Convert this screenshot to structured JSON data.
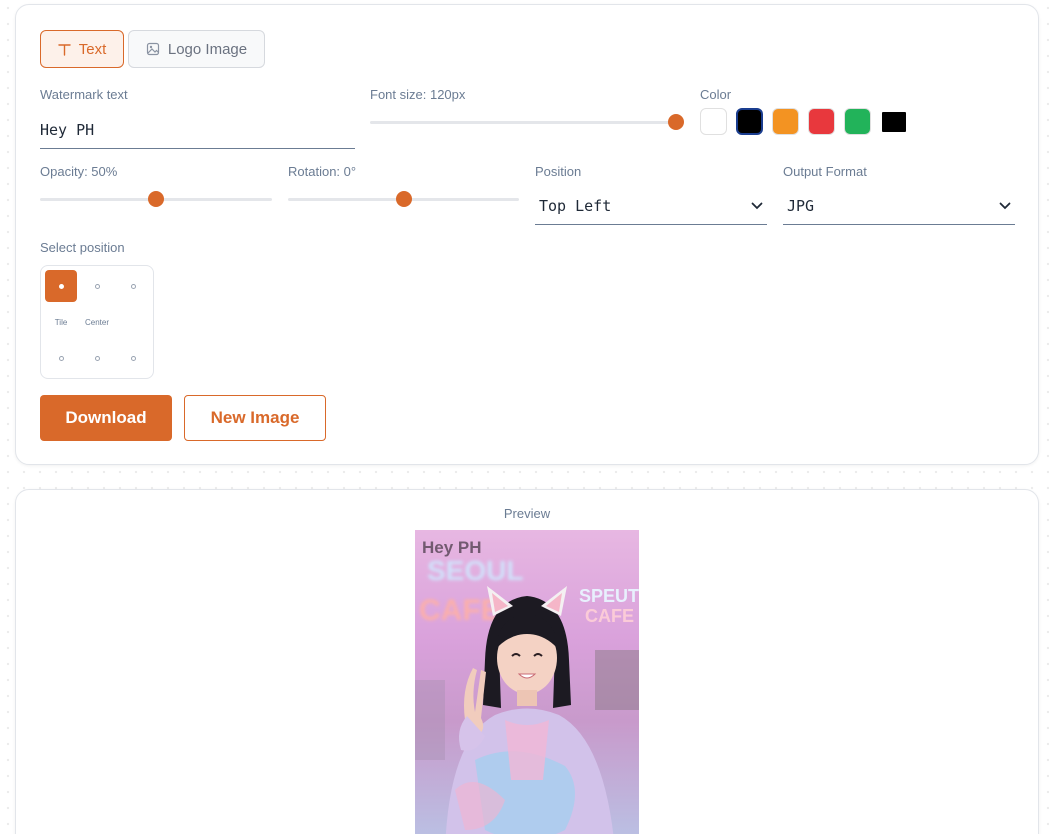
{
  "tabs": {
    "text_label": "Text",
    "logo_label": "Logo Image"
  },
  "watermark": {
    "text_label": "Watermark text",
    "text_value": "Hey PH"
  },
  "font_size": {
    "label": "Font size: 120px",
    "value_fraction": 1.0
  },
  "color": {
    "label": "Color",
    "swatches": [
      "#ffffff",
      "#000000",
      "#f39322",
      "#e8383d",
      "#22b35a",
      "#000000"
    ],
    "selected_index": 1
  },
  "opacity": {
    "label": "Opacity: 50%",
    "value_fraction": 0.5
  },
  "rotation": {
    "label": "Rotation: 0°",
    "value_fraction": 0.5
  },
  "position": {
    "label": "Position",
    "selected": "Top Left"
  },
  "output_format": {
    "label": "Output Format",
    "selected": "JPG"
  },
  "position_grid": {
    "label": "Select position",
    "tile_label": "Tile",
    "center_label": "Center",
    "selected": "top-left"
  },
  "buttons": {
    "download": "Download",
    "new_image": "New Image"
  },
  "preview": {
    "label": "Preview",
    "overlay_text": "Hey PH",
    "sign_text_1": "SEOUL",
    "sign_text_2": "CAFE",
    "sign_text_3": "SPEUT",
    "sign_text_4": "CAFE"
  },
  "accent_color": "#d9692a",
  "icons": {
    "text_tab": "text-type-icon",
    "logo_tab": "image-icon",
    "select_arrow": "chevron-down-icon"
  }
}
